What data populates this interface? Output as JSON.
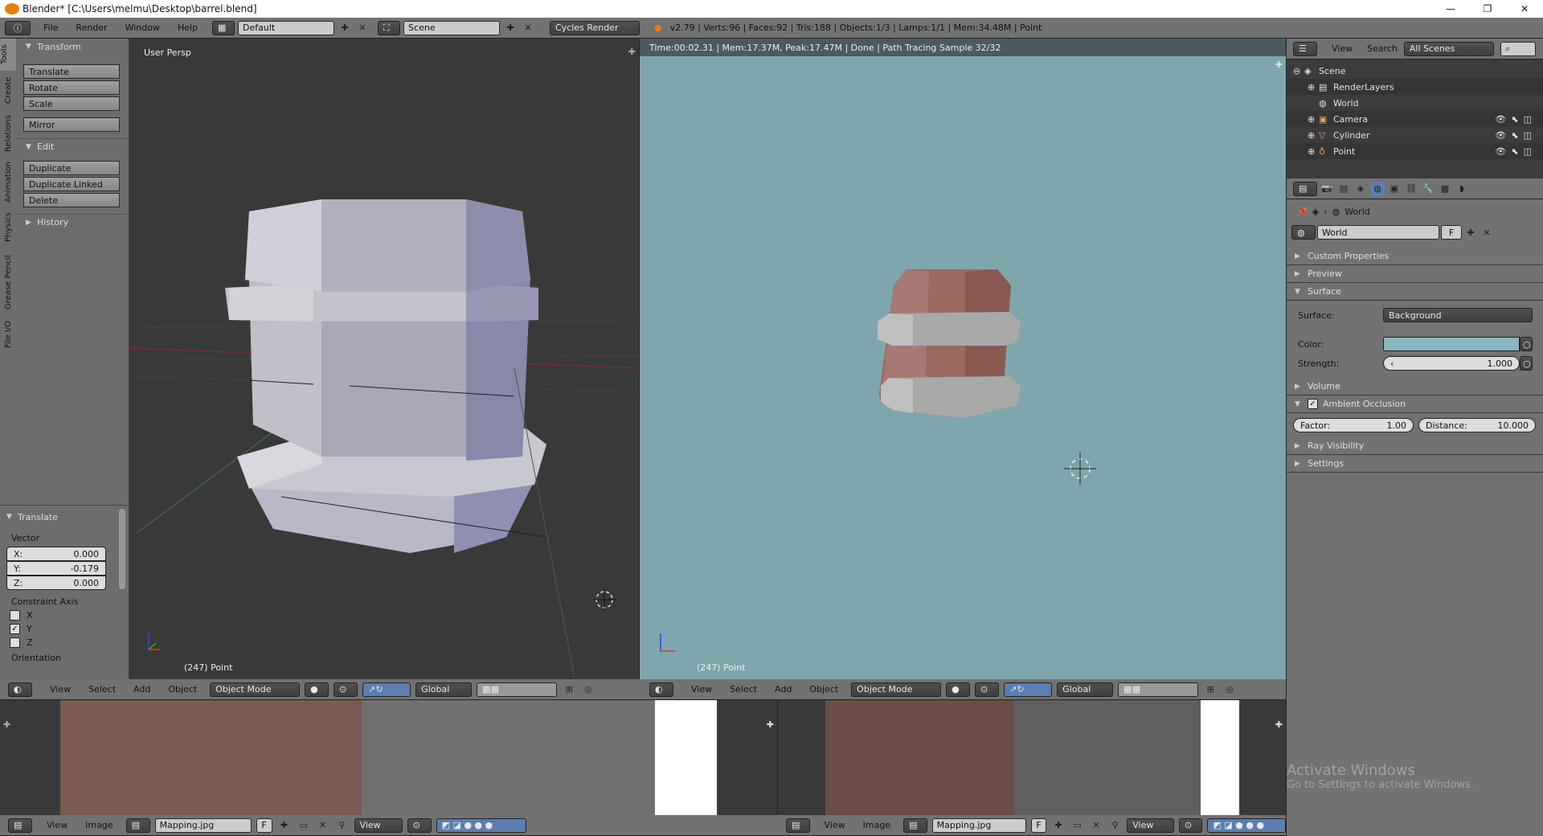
{
  "window": {
    "title": "Blender* [C:\\Users\\melmu\\Desktop\\barrel.blend]",
    "controls": [
      "—",
      "❐",
      "✕"
    ]
  },
  "info_bar": {
    "menus": [
      "File",
      "Render",
      "Window",
      "Help"
    ],
    "layout": "Default",
    "scene": "Scene",
    "engine": "Cycles Render",
    "stats": "v2.79 | Verts:96 | Faces:92 | Tris:188 | Objects:1/3 | Lamps:1/1 | Mem:34.48M | Point"
  },
  "tool_shelf": {
    "tabs": [
      "Tools",
      "Create",
      "Relations",
      "Animation",
      "Physics",
      "Grease Pencil",
      "File I/O"
    ],
    "transform": {
      "title": "Transform",
      "buttons": [
        "Translate",
        "Rotate",
        "Scale",
        "Mirror"
      ]
    },
    "edit": {
      "title": "Edit",
      "buttons": [
        "Duplicate",
        "Duplicate Linked",
        "Delete"
      ]
    },
    "history": {
      "title": "History"
    }
  },
  "operator_panel": {
    "title": "Translate",
    "vector_label": "Vector",
    "x": {
      "label": "X:",
      "value": "0.000"
    },
    "y": {
      "label": "Y:",
      "value": "-0.179"
    },
    "z": {
      "label": "Z:",
      "value": "0.000"
    },
    "constraint_label": "Constraint Axis",
    "axes": [
      {
        "label": "X",
        "checked": false
      },
      {
        "label": "Y",
        "checked": true
      },
      {
        "label": "Z",
        "checked": false
      }
    ],
    "orientation_label": "Orientation"
  },
  "viewport_left": {
    "label": "User Persp",
    "object_info": "(247) Point",
    "header": {
      "menus": [
        "View",
        "Select",
        "Add",
        "Object"
      ],
      "mode": "Object Mode",
      "orientation": "Global"
    }
  },
  "viewport_right": {
    "render_status": "Time:00:02.31 | Mem:17.37M, Peak:17.47M | Done | Path Tracing Sample 32/32",
    "object_info": "(247) Point",
    "header": {
      "menus": [
        "View",
        "Select",
        "Add",
        "Object"
      ],
      "mode": "Object Mode",
      "orientation": "Global"
    }
  },
  "outliner": {
    "menus": [
      "View",
      "Search"
    ],
    "filter": "All Scenes",
    "items": [
      {
        "label": "Scene",
        "level": 0,
        "icon": "scene-icon"
      },
      {
        "label": "RenderLayers",
        "level": 1,
        "icon": "render-layers-icon"
      },
      {
        "label": "World",
        "level": 1,
        "icon": "world-icon"
      },
      {
        "label": "Camera",
        "level": 1,
        "icon": "camera-icon"
      },
      {
        "label": "Cylinder",
        "level": 1,
        "icon": "mesh-icon"
      },
      {
        "label": "Point",
        "level": 1,
        "icon": "lamp-icon"
      }
    ]
  },
  "properties": {
    "breadcrumb": "World",
    "datablock": "World",
    "fake_user": "F",
    "panels": {
      "custom_properties": "Custom Properties",
      "preview": "Preview",
      "surface": "Surface",
      "volume": "Volume",
      "ambient_occlusion": "Ambient Occlusion",
      "ray_visibility": "Ray Visibility",
      "settings": "Settings"
    },
    "surface_label": "Surface:",
    "surface_value": "Background",
    "color_label": "Color:",
    "color_value": "#8ab8c0",
    "strength_label": "Strength:",
    "strength_value": "1.000",
    "factor_label": "Factor:",
    "factor_value": "1.00",
    "distance_label": "Distance:",
    "distance_value": "10.000"
  },
  "image_editors": [
    {
      "menus": [
        "View",
        "Image"
      ],
      "image": "Mapping.jpg",
      "fake_user": "F",
      "view": "View"
    },
    {
      "menus": [
        "View",
        "Image"
      ],
      "image": "Mapping.jpg",
      "fake_user": "F",
      "view": "View"
    }
  ],
  "watermark": {
    "title": "Activate Windows",
    "subtitle": "Go to Settings to activate Windows."
  },
  "colors": {
    "world_background": "#7fa6ad",
    "barrel_wood": "#9a6a60",
    "barrel_band": "#a8a8a8"
  }
}
